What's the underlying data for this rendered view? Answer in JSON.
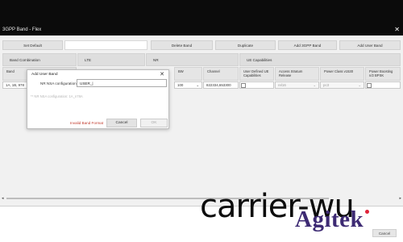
{
  "window": {
    "title": "3GPP Band - Flex"
  },
  "toolbar": {
    "set_default": "Set Default",
    "delete_band": "Delete Band",
    "duplicate": "Duplicate",
    "add_3gpp_band": "Add 3GPP Band",
    "add_user_band": "Add User Band"
  },
  "groups": {
    "band_combination": "Band Combination",
    "lte": "LTE",
    "nr": "NR",
    "ue_capabilities": "UE Capabilities"
  },
  "columns": {
    "band": "Band",
    "bw": "BW",
    "channel": "Channel",
    "user_defined": "User Defined UE Capabilities",
    "access_stratum": "Access Stratum Release",
    "power_class": "Power Class v1530",
    "power_boosting": "Power Boosting n/2 BPSK"
  },
  "row": {
    "band": "1A, 1B, 978",
    "bw": "100",
    "channel": "822334,653300",
    "access_stratum": "rel16",
    "power_class": "pc3"
  },
  "dialog": {
    "title": "Add User Band",
    "field_label": "NR NSA configuration:",
    "field_value": "USER_|",
    "hint": "** NR NSA configuration: 1A_n78A",
    "error": "Invalid Band Format",
    "cancel": "Cancel",
    "ok": "OK"
  },
  "overlay": {
    "caption": "carrier-wu"
  },
  "brand": {
    "name": "Agitek"
  },
  "footer": {
    "cancel": "Cancel"
  },
  "icons": {
    "close": "close-icon",
    "dropdown": "chevron-down-icon"
  },
  "colors": {
    "titlebar": "#0b0b0b",
    "brand": "#3d2a73",
    "error": "#c0392b"
  }
}
